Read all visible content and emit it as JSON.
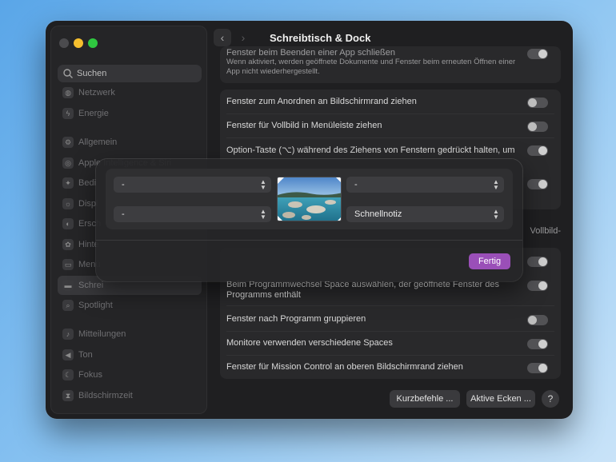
{
  "window": {
    "title": "Schreibtisch & Dock"
  },
  "search": {
    "placeholder": "Suchen"
  },
  "sidebar": {
    "items": [
      {
        "label": "Netzwerk",
        "icon": "globe-icon"
      },
      {
        "label": "Energie",
        "icon": "bolt-icon"
      },
      {
        "label": "Allgemein",
        "icon": "gear-icon"
      },
      {
        "label": "Apple Intelligence & Siri",
        "icon": "siri-icon"
      },
      {
        "label": "Bedi",
        "icon": "accessibility-icon"
      },
      {
        "label": "Displ",
        "icon": "sun-icon"
      },
      {
        "label": "Ersch",
        "icon": "appearance-icon"
      },
      {
        "label": "Hinte",
        "icon": "flower-icon"
      },
      {
        "label": "Menü",
        "icon": "menu-bar-icon"
      },
      {
        "label": "Schrei",
        "icon": "dock-icon"
      },
      {
        "label": "Spotlight",
        "icon": "magnifier-icon"
      },
      {
        "label": "Mitteilungen",
        "icon": "bell-icon"
      },
      {
        "label": "Ton",
        "icon": "speaker-icon"
      },
      {
        "label": "Fokus",
        "icon": "moon-icon"
      },
      {
        "label": "Bildschirmzeit",
        "icon": "hourglass-icon"
      }
    ]
  },
  "settings": {
    "close_windows": {
      "label": "Fenster beim Beenden einer App schließen",
      "sub": "Wenn aktiviert, werden geöffnete Dokumente und Fenster beim erneuten Öffnen einer App nicht wiederhergestellt."
    },
    "drag_edge": {
      "label": "Fenster zum Anordnen an Bildschirmrand ziehen"
    },
    "drag_menubar": {
      "label": "Fenster für Vollbild in Menüleiste ziehen"
    },
    "option_key": {
      "label": "Option-Taste (⌥) während des Ziehens von Fenstern gedrückt halten, um"
    },
    "vollbild_fragment": "Vollbild-",
    "space_switch": {
      "label": "Beim Programmwechsel Space auswählen, der geöffnete Fenster des Programms enthält"
    },
    "group_apps": {
      "label": "Fenster nach Programm gruppieren"
    },
    "separate_spaces": {
      "label": "Monitore verwenden verschiedene Spaces"
    },
    "mission_control_top": {
      "label": "Fenster für Mission Control an oberen Bildschirmrand ziehen"
    }
  },
  "bottom_buttons": {
    "shortcuts": "Kurzbefehle ...",
    "hot_corners": "Aktive Ecken ...",
    "help": "?"
  },
  "hot_corners_sheet": {
    "top_left": "-",
    "top_right": "-",
    "bottom_left": "-",
    "bottom_right": "Schnellnotiz",
    "done": "Fertig"
  },
  "colors": {
    "accent": "#9a4fb8",
    "window_bg": "#1f1f21",
    "traffic_min": "#f6bf2e",
    "traffic_zoom": "#2fc840"
  }
}
